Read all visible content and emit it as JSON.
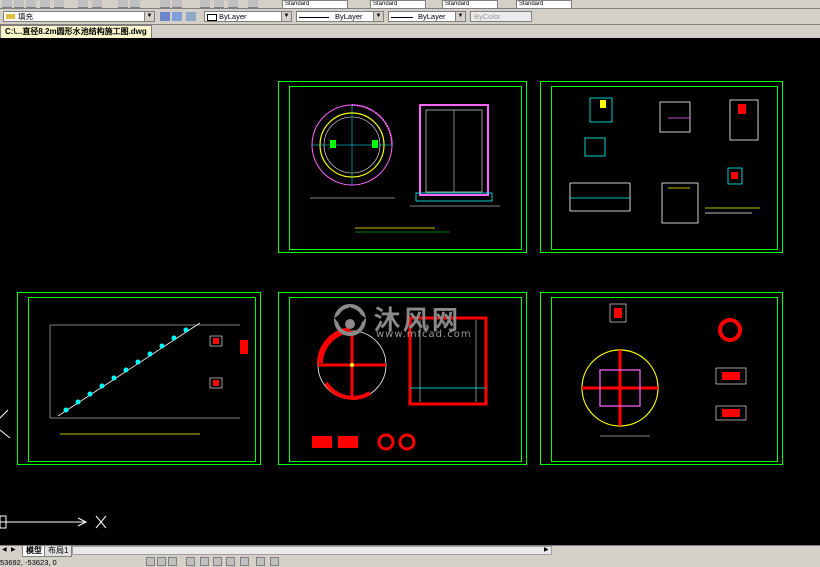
{
  "toolbar": {
    "fill_combo": "填充",
    "layer_color": "ByLayer",
    "linetype": "ByLayer",
    "lineweight": "ByLayer",
    "plotstyle": "ByColor",
    "text_style": "Standard",
    "dim_style": "Standard",
    "table_style": "Standard",
    "multileader_style": "Standard"
  },
  "document_tab": {
    "title": "C:\\...直径8.2m圆形水池结构施工图.dwg"
  },
  "layout_tabs": [
    {
      "label": "模型"
    },
    {
      "label": "布局1"
    }
  ],
  "status": {
    "coordinates": "53692, -53623, 0"
  },
  "watermark": {
    "brand": "沐风网",
    "url": "www.mfcad.com"
  },
  "colors": {
    "frame": "#00ff00",
    "accent_red": "#ff0000",
    "accent_cyan": "#00ffff",
    "accent_yellow": "#ffff00",
    "accent_magenta": "#ff00ff"
  }
}
